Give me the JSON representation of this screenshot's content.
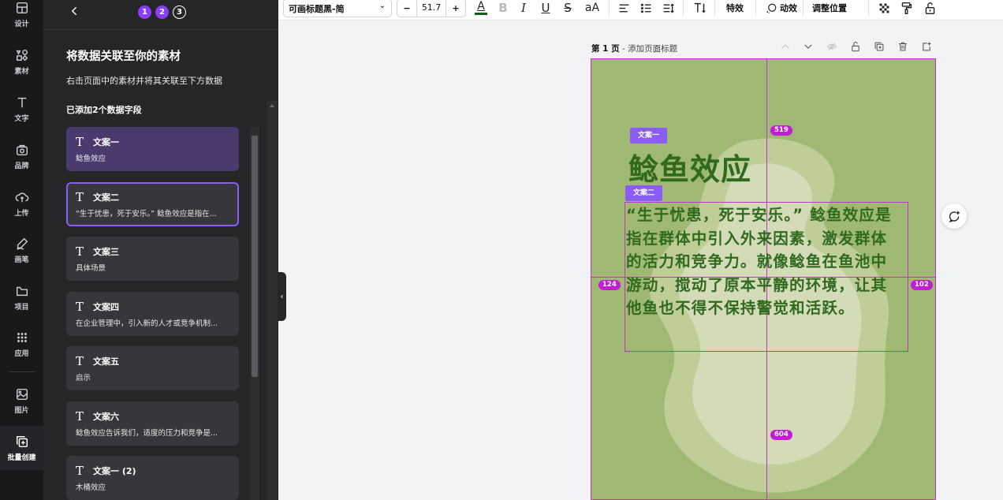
{
  "rail": [
    {
      "label": "设计",
      "icon": "layout-icon"
    },
    {
      "label": "素材",
      "icon": "elements-icon"
    },
    {
      "label": "文字",
      "icon": "text-icon"
    },
    {
      "label": "品牌",
      "icon": "brand-icon"
    },
    {
      "label": "上传",
      "icon": "upload-cloud-icon"
    },
    {
      "label": "画笔",
      "icon": "draw-pen-icon"
    },
    {
      "label": "项目",
      "icon": "folder-icon"
    },
    {
      "label": "应用",
      "icon": "apps-grid-icon"
    },
    {
      "label": "图片",
      "icon": "image-icon"
    },
    {
      "label": "批量创建",
      "icon": "bulk-create-icon"
    }
  ],
  "panel": {
    "steps": [
      "1",
      "2",
      "3"
    ],
    "title": "将数据关联至你的素材",
    "subtitle": "右击页面中的素材并将其关联至下方数据",
    "count_text": "已添加2个数据字段",
    "fields": [
      {
        "name": "文案一",
        "value": "鲶鱼效应"
      },
      {
        "name": "文案二",
        "value": "“生于忧患，死于安乐。” 鲶鱼效应是指在..."
      },
      {
        "name": "文案三",
        "value": "具体场景"
      },
      {
        "name": "文案四",
        "value": "在企业管理中，引入新的人才或竞争机制..."
      },
      {
        "name": "文案五",
        "value": "启示"
      },
      {
        "name": "文案六",
        "value": "鲶鱼效应告诉我们，适度的压力和竞争是..."
      },
      {
        "name": "文案一 (2)",
        "value": "木桶效应"
      }
    ]
  },
  "toolbar": {
    "font": "可画标题黑-简",
    "font_size": "51.7",
    "minus": "−",
    "plus": "+",
    "effects": "特效",
    "animate": "动效",
    "position": "调整位置",
    "text_color": "#1d5b1d"
  },
  "page": {
    "label_prefix": "第 1 页",
    "label_suffix": " - 添加页面标题"
  },
  "canvas": {
    "tag1": "文案一",
    "tag2": "文案二",
    "heading": "鲶鱼效应",
    "body": "“生于忧患，死于安乐。” 鲶鱼效应是指在群体中引入外来因素，激发群体的活力和竞争力。就像鲶鱼在鱼池中游动，搅动了原本平静的环境，让其他鱼也不得不保持警觉和活跃。",
    "measure_top": "519",
    "measure_left": "124",
    "measure_right": "102",
    "measure_bottom": "604",
    "bg_color": "#9fb873",
    "text_color": "#2f6a1f",
    "accent": "#8b5cf6"
  }
}
